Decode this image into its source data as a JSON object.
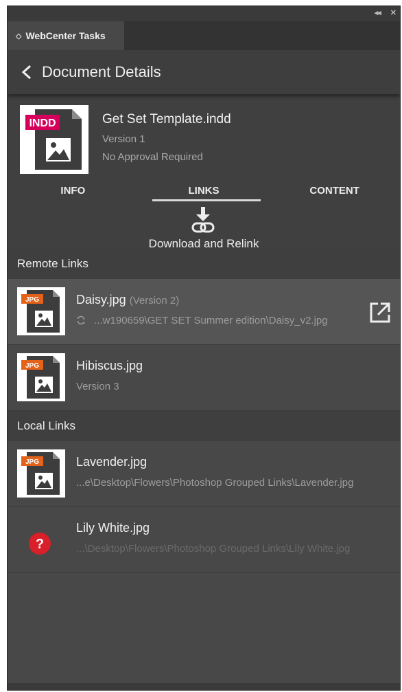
{
  "panel": {
    "tab_label": "WebCenter Tasks",
    "collapse_glyph": "◂◂",
    "close_glyph": "✕"
  },
  "header": {
    "title": "Document Details"
  },
  "document": {
    "type_badge": "INDD",
    "name": "Get Set Template.indd",
    "version": "Version 1",
    "approval": "No Approval Required"
  },
  "tabs": [
    {
      "label": "INFO",
      "active": false
    },
    {
      "label": "LINKS",
      "active": true
    },
    {
      "label": "CONTENT",
      "active": false
    }
  ],
  "relink": {
    "label": "Download and Relink",
    "icon": "download-link-icon"
  },
  "remote_links": {
    "title": "Remote Links",
    "items": [
      {
        "badge": "JPG",
        "name": "Daisy.jpg",
        "version": "(Version 2)",
        "path": "...w190659\\GET SET Summer edition\\Daisy_v2.jpg",
        "icon": "external-link-icon"
      },
      {
        "badge": "JPG",
        "name": "Hibiscus.jpg",
        "path": "Version 3"
      }
    ]
  },
  "local_links": {
    "title": "Local Links",
    "items": [
      {
        "badge": "JPG",
        "name": "Lavender.jpg",
        "path": "...e\\Desktop\\Flowers\\Photoshop Grouped Links\\Lavender.jpg"
      },
      {
        "name": "Lily White.jpg",
        "path": "...\\Desktop\\Flowers\\Photoshop Grouped Links\\Lily White.jpg",
        "icon": "missing-link-icon"
      }
    ]
  },
  "colors": {
    "indd_badge": "#d6005c",
    "jpg_badge": "#e4621a",
    "missing": "#d81f2a",
    "panel_bg": "#484848"
  }
}
